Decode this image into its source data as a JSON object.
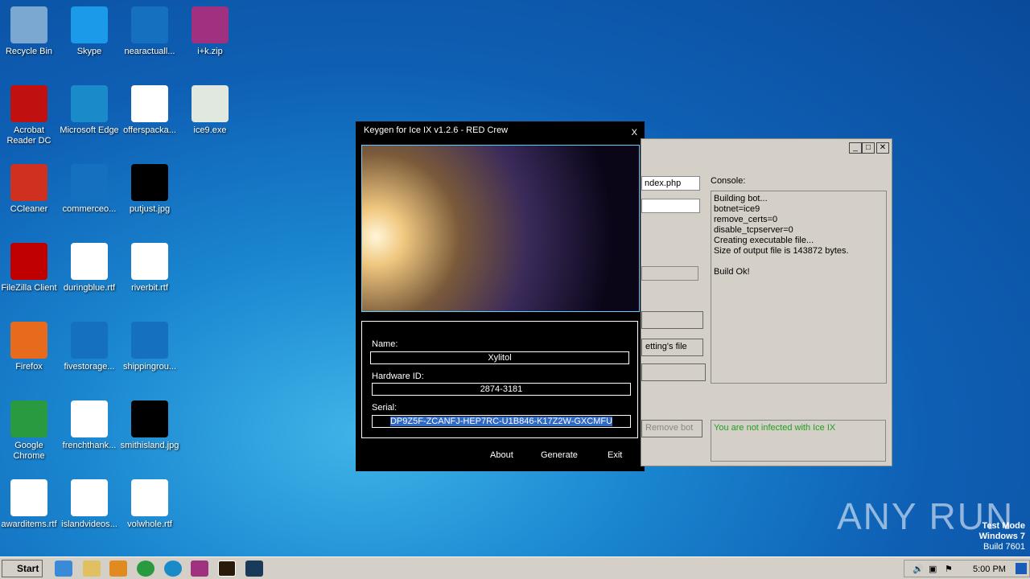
{
  "desktop": {
    "icons": [
      {
        "label": "Recycle Bin",
        "col": 0,
        "row": 0,
        "color": "#7aa8d0"
      },
      {
        "label": "Acrobat Reader DC",
        "col": 0,
        "row": 1,
        "color": "#c01010"
      },
      {
        "label": "CCleaner",
        "col": 0,
        "row": 2,
        "color": "#d03020"
      },
      {
        "label": "FileZilla Client",
        "col": 0,
        "row": 3,
        "color": "#c00000"
      },
      {
        "label": "Firefox",
        "col": 0,
        "row": 4,
        "color": "#e86a1c"
      },
      {
        "label": "Google Chrome",
        "col": 0,
        "row": 5,
        "color": "#2a9a40"
      },
      {
        "label": "awarditems.rtf",
        "col": 0,
        "row": 6,
        "color": "#ffffff"
      },
      {
        "label": "Skype",
        "col": 1,
        "row": 0,
        "color": "#1a9ae8"
      },
      {
        "label": "Microsoft Edge",
        "col": 1,
        "row": 1,
        "color": "#1a8ac8"
      },
      {
        "label": "commerceo...",
        "col": 1,
        "row": 2,
        "color": "#1670c0"
      },
      {
        "label": "duringblue.rtf",
        "col": 1,
        "row": 3,
        "color": "#ffffff"
      },
      {
        "label": "fivestorage...",
        "col": 1,
        "row": 4,
        "color": "#1670c0"
      },
      {
        "label": "frenchthank...",
        "col": 1,
        "row": 5,
        "color": "#ffffff"
      },
      {
        "label": "islandvideos...",
        "col": 1,
        "row": 6,
        "color": "#ffffff"
      },
      {
        "label": "nearactuall...",
        "col": 2,
        "row": 0,
        "color": "#1670c0"
      },
      {
        "label": "offerspacka...",
        "col": 2,
        "row": 1,
        "color": "#ffffff"
      },
      {
        "label": "putjust.jpg",
        "col": 2,
        "row": 2,
        "color": "#000000"
      },
      {
        "label": "riverbit.rtf",
        "col": 2,
        "row": 3,
        "color": "#ffffff"
      },
      {
        "label": "shippingrou...",
        "col": 2,
        "row": 4,
        "color": "#1670c0"
      },
      {
        "label": "smithisland.jpg",
        "col": 2,
        "row": 5,
        "color": "#000000"
      },
      {
        "label": "volwhole.rtf",
        "col": 2,
        "row": 6,
        "color": "#ffffff"
      },
      {
        "label": "i+k.zip",
        "col": 3,
        "row": 0,
        "color": "#a03080"
      },
      {
        "label": "ice9.exe",
        "col": 3,
        "row": 1,
        "color": "#e0e8e0"
      }
    ]
  },
  "keygen": {
    "title": "Keygen for Ice IX v1.2.6 - RED Crew",
    "close": "X",
    "name_label": "Name:",
    "name_value": "Xylitol",
    "hwid_label": "Hardware ID:",
    "hwid_value": "2874-3181",
    "serial_label": "Serial:",
    "serial_value": "DP9Z5F-ZCANFJ-HEP7RC-U1B846-K17Z2W-GXCMFU",
    "about": "About",
    "generate": "Generate",
    "exit": "Exit"
  },
  "builder": {
    "url_value": "ndex.php",
    "console_label": "Console:",
    "console_lines": [
      "Building bot...",
      "botnet=ice9",
      "remove_certs=0",
      "disable_tcpserver=0",
      "Creating executable file...",
      "Size of output file is 143872 bytes.",
      "",
      "Build Ok!"
    ],
    "settings_button": "etting's file",
    "remove_bot": "Remove bot",
    "status": "You are not infected with Ice IX",
    "status_color": "#20a020"
  },
  "watermark": {
    "text": "ANY RUN",
    "test_mode": "Test Mode",
    "os": "Windows 7",
    "build": "Build 7601"
  },
  "taskbar": {
    "start": "Start",
    "clock": "5:00 PM"
  }
}
